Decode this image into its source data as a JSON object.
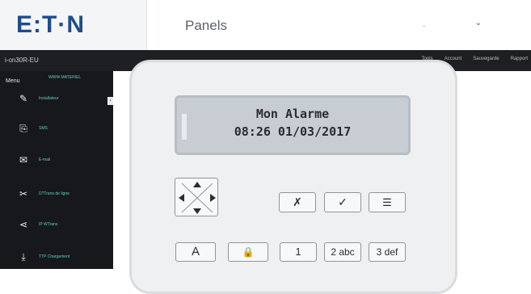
{
  "header": {
    "logo": "E:T·N",
    "title": "Panels",
    "lang": "..",
    "lang_chevron": "⌄"
  },
  "topbar": {
    "device": "i-on30R-EU",
    "nav": [
      "Tools",
      "Account",
      "Sauvegarde",
      "Rapport"
    ]
  },
  "sidebar": {
    "menu": "Menu",
    "sub": "WWW MATERIEL",
    "collapse": "‹",
    "items": [
      {
        "icon": "wrench-icon",
        "glyph": "✎",
        "label": "Installateur"
      },
      {
        "icon": "sms-icon",
        "glyph": "⎘",
        "label": "SMS"
      },
      {
        "icon": "email-icon",
        "glyph": "✉",
        "label": "E-mail"
      },
      {
        "icon": "tools-icon",
        "glyph": "✂",
        "label": "D?Trans de ligne"
      },
      {
        "icon": "share-icon",
        "glyph": "⋖",
        "label": "IP WTrans"
      },
      {
        "icon": "download-icon",
        "glyph": "⤓",
        "label": "TTP Chargement"
      }
    ]
  },
  "panel": {
    "lcd": {
      "line1": "Mon Alarme",
      "line2": "08:26 01/03/2017"
    },
    "buttons": {
      "cancel": "✗",
      "ok": "✓",
      "menu": "☰",
      "a": "A",
      "lock": "🔒",
      "k1": "1",
      "k2": "2 abc",
      "k3": "3 def"
    }
  }
}
